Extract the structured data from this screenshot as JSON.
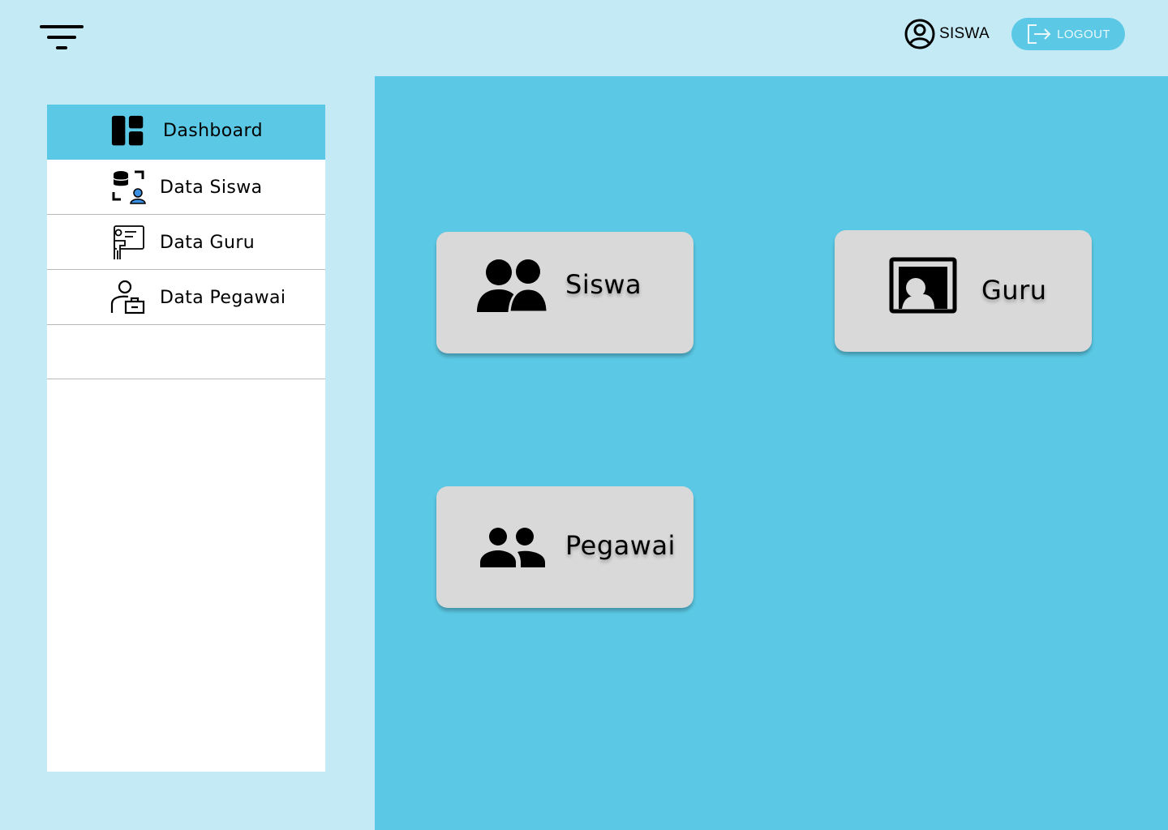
{
  "header": {
    "menu_icon": "filter-menu-icon",
    "user_icon": "user-circle-icon",
    "user_name": "SISWA",
    "logout_icon": "logout-icon",
    "logout_label": "LOGOUT"
  },
  "sidebar": {
    "items": [
      {
        "label": "Dashboard",
        "icon": "dashboard-icon",
        "active": true
      },
      {
        "label": "Data Siswa",
        "icon": "student-database-icon",
        "active": false
      },
      {
        "label": "Data Guru",
        "icon": "teacher-board-icon",
        "active": false
      },
      {
        "label": "Data Pegawai",
        "icon": "employee-icon",
        "active": false
      }
    ]
  },
  "main": {
    "cards": [
      {
        "label": "Siswa",
        "icon": "group-icon"
      },
      {
        "label": "Guru",
        "icon": "teacher-portrait-icon"
      },
      {
        "label": "Pegawai",
        "icon": "people-icon"
      }
    ]
  },
  "colors": {
    "page_background": "#c3eaf5",
    "accent": "#5bc9e5",
    "card": "#d9d9d9",
    "sidebar": "#ffffff"
  }
}
